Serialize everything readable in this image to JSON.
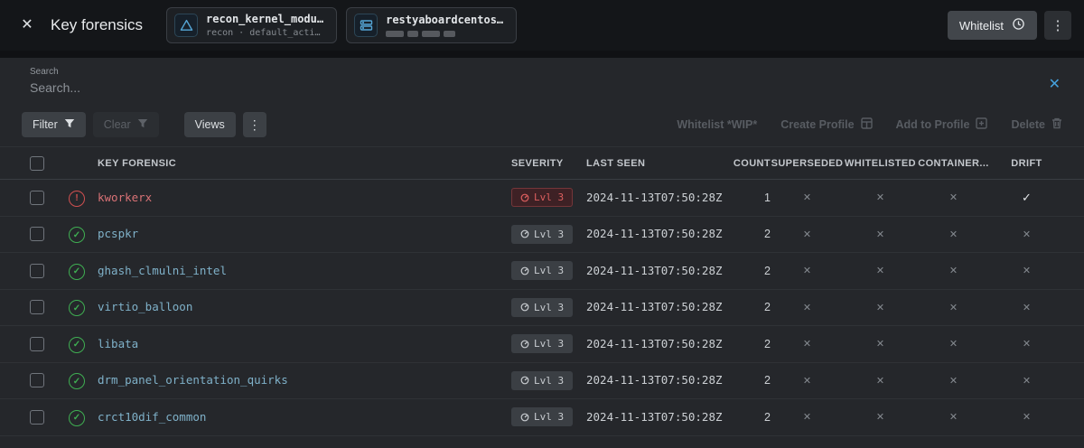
{
  "header": {
    "close_icon": "✕",
    "title": "Key forensics",
    "chips": [
      {
        "icon": "alert-triangle-icon",
        "label": "recon_kernel_modu…",
        "sub": "recon · default_acti…"
      },
      {
        "icon": "server-icon",
        "label": "restyaboardcentos…",
        "sub_redacted": true
      }
    ],
    "whitelist_label": "Whitelist",
    "menu_icon": "⋮"
  },
  "search": {
    "label": "Search",
    "placeholder": "Search...",
    "clear_icon": "✕"
  },
  "toolbar": {
    "filter": "Filter",
    "clear": "Clear",
    "views": "Views",
    "menu_icon": "⋮",
    "whitelist_wip": "Whitelist *WIP*",
    "create_profile": "Create Profile",
    "add_to_profile": "Add to Profile",
    "delete": "Delete"
  },
  "table": {
    "columns": [
      "KEY FORENSIC",
      "SEVERITY",
      "LAST SEEN",
      "COUNT",
      "SUPERSEDED",
      "WHITELISTED",
      "CONTAINER...",
      "DRIFT"
    ],
    "rows": [
      {
        "name": "kworkerx",
        "status": "alert",
        "critical": true,
        "severity": "Lvl 3",
        "last_seen": "2024-11-13T07:50:28Z",
        "count": "1",
        "superseded": false,
        "whitelisted": false,
        "container": false,
        "drift": true
      },
      {
        "name": "pcspkr",
        "status": "ok",
        "critical": false,
        "severity": "Lvl 3",
        "last_seen": "2024-11-13T07:50:28Z",
        "count": "2",
        "superseded": false,
        "whitelisted": false,
        "container": false,
        "drift": false
      },
      {
        "name": "ghash_clmulni_intel",
        "status": "ok",
        "critical": false,
        "severity": "Lvl 3",
        "last_seen": "2024-11-13T07:50:28Z",
        "count": "2",
        "superseded": false,
        "whitelisted": false,
        "container": false,
        "drift": false
      },
      {
        "name": "virtio_balloon",
        "status": "ok",
        "critical": false,
        "severity": "Lvl 3",
        "last_seen": "2024-11-13T07:50:28Z",
        "count": "2",
        "superseded": false,
        "whitelisted": false,
        "container": false,
        "drift": false
      },
      {
        "name": "libata",
        "status": "ok",
        "critical": false,
        "severity": "Lvl 3",
        "last_seen": "2024-11-13T07:50:28Z",
        "count": "2",
        "superseded": false,
        "whitelisted": false,
        "container": false,
        "drift": false
      },
      {
        "name": "drm_panel_orientation_quirks",
        "status": "ok",
        "critical": false,
        "severity": "Lvl 3",
        "last_seen": "2024-11-13T07:50:28Z",
        "count": "2",
        "superseded": false,
        "whitelisted": false,
        "container": false,
        "drift": false
      },
      {
        "name": "crct10dif_common",
        "status": "ok",
        "critical": false,
        "severity": "Lvl 3",
        "last_seen": "2024-11-13T07:50:28Z",
        "count": "2",
        "superseded": false,
        "whitelisted": false,
        "container": false,
        "drift": false
      }
    ]
  },
  "colors": {
    "accent_blue": "#45a1dc",
    "link_blue": "#7fb1c9",
    "alert_red": "#d05050",
    "ok_green": "#3fae52",
    "panel_bg": "#25272b",
    "topbar_bg": "#141619"
  }
}
